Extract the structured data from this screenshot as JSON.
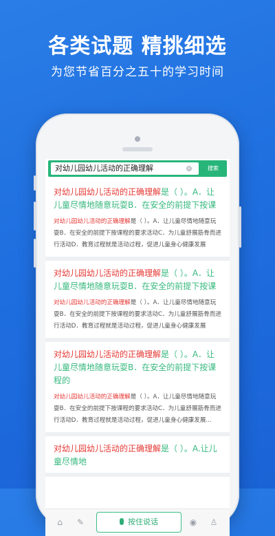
{
  "headline": "各类试题 精挑细选",
  "subline": "为您节省百分之五十的学习时间",
  "search": {
    "query": "对幼儿园幼儿活动的正确理解",
    "button": "搜索"
  },
  "results": [
    {
      "title_hl": "对幼儿园幼儿活动的正确理解",
      "title_rest": "是（ ）。A．让儿童尽情地随意玩耍B．在安全的前提下按课",
      "body_hl": "对幼儿园幼儿活动的正确理解",
      "body_rest": "是（ ）。A．让儿童尽情地随意玩耍B．在安全的前提下按课程的要求活动C．为儿童舒展筋骨而进行活动D．教育过程就是活动过程，促进儿童身心健康发展"
    },
    {
      "title_hl": "对幼儿园幼儿活动的正确理解",
      "title_rest": "是（ ）。A．让儿童尽情地随意玩耍B．在安全的前提下按课",
      "body_hl": "对幼儿园幼儿活动的正确理解",
      "body_rest": "是（ ）。A．让儿童尽情地随意玩耍B．在安全的前提下按课程的要求活动C．为儿童舒展筋骨而进行活动D．教育过程就是活动过程，促进儿童身心健康发展"
    },
    {
      "title_hl": "对幼儿园幼儿活动的正确理解",
      "title_rest": "是（ ）。A．让儿童尽情地随意玩耍B．在安全的前提下按课程的",
      "body_hl": "对幼儿园幼儿活动的正确理解",
      "body_rest": "是（ ）。A．让儿童尽情地随意玩耍B．在安全的前提下按课程的要求活动C．为儿童舒展筋骨而进行活动D．教育过程就是活动过程，促进儿童身心健康发展..."
    },
    {
      "title_hl": "对幼儿园幼儿活动的正确理解",
      "title_rest": "是（ ）。A.让儿童尽情地",
      "body_hl": "",
      "body_rest": ""
    }
  ],
  "toolbar": {
    "home_icon": "home-icon",
    "edit_icon": "edit-icon",
    "voice_label": "按住说话",
    "camera_icon": "camera-icon",
    "profile_icon": "profile-icon"
  },
  "colors": {
    "background": "#1f6fe0",
    "accent_green": "#27b57a",
    "highlight_red": "#e53935"
  }
}
